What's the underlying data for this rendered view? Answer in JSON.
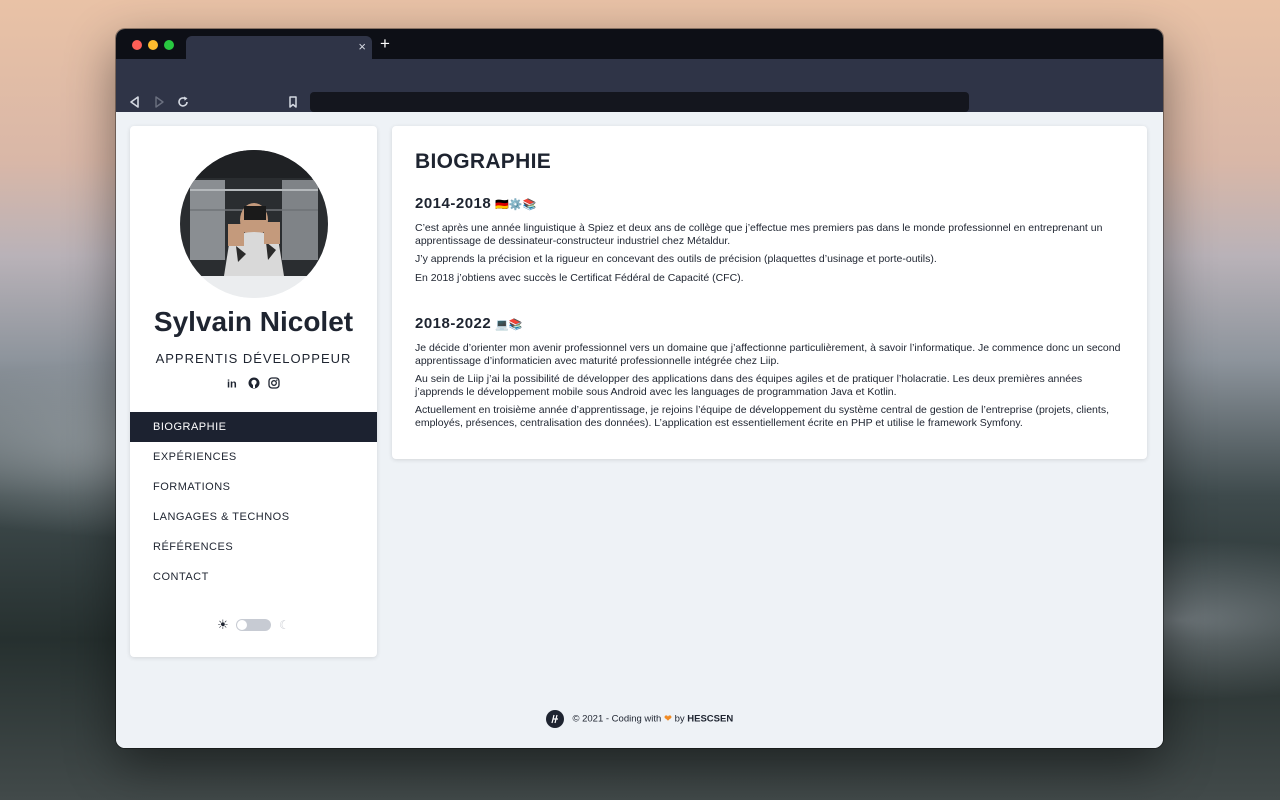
{
  "browser": {
    "tab_close": "×",
    "new_tab": "+"
  },
  "profile": {
    "name": "Sylvain Nicolet",
    "role": "APPRENTIS DÉVELOPPEUR",
    "social_icons": [
      "linkedin-icon",
      "github-icon",
      "instagram-icon"
    ],
    "linkedin_glyph": "in"
  },
  "menu": {
    "items": [
      {
        "label": "BIOGRAPHIE",
        "active": true
      },
      {
        "label": "EXPÉRIENCES"
      },
      {
        "label": "FORMATIONS"
      },
      {
        "label": "LANGAGES & TECHNOS"
      },
      {
        "label": "RÉFÉRENCES"
      },
      {
        "label": "CONTACT"
      }
    ]
  },
  "theme_toggle": {
    "sun": "☀",
    "moon": "☾",
    "dark_mode": false
  },
  "main": {
    "title": "BIOGRAPHIE",
    "sections": [
      {
        "heading": "2014-2018",
        "emojis": "🇩🇪⚙️📚",
        "paragraphs": [
          "C’est après une année linguistique à Spiez et deux ans de collège que j’effectue mes premiers pas dans le monde professionnel en entreprenant un apprentissage de dessinateur-constructeur industriel chez Métaldur.",
          "J’y apprends la précision et la rigueur en concevant des outils de précision (plaquettes d’usinage et porte-outils).",
          "En 2018 j’obtiens avec succès le Certificat Fédéral de Capacité (CFC)."
        ]
      },
      {
        "heading": "2018-2022",
        "emojis": "💻📚",
        "paragraphs": [
          "Je décide d’orienter mon avenir professionnel vers un domaine que j’affectionne particulièrement, à savoir l’informatique. Je commence donc un second apprentissage d’informaticien avec maturité professionnelle intégrée chez Liip.",
          "Au sein de Liip j’ai la possibilité de développer des applications dans des équipes agiles et de pratiquer l’holacratie. Les deux premières années j’apprends le développement mobile sous Android avec les languages de programmation Java et Kotlin.",
          "Actuellement en troisième année d’apprentissage, je rejoins l’équipe de développement du système central de gestion de l’entreprise (projets, clients, employés, présences, centralisation des données). L’application est essentiellement écrite en PHP et utilise le framework Symfony."
        ]
      }
    ]
  },
  "footer": {
    "prefix": "© 2021 - Coding with",
    "heart": "❤",
    "by": "by",
    "brand": "HESCSEN"
  },
  "colors": {
    "accent_dark": "#1c2230",
    "heart": "#f08a24"
  }
}
